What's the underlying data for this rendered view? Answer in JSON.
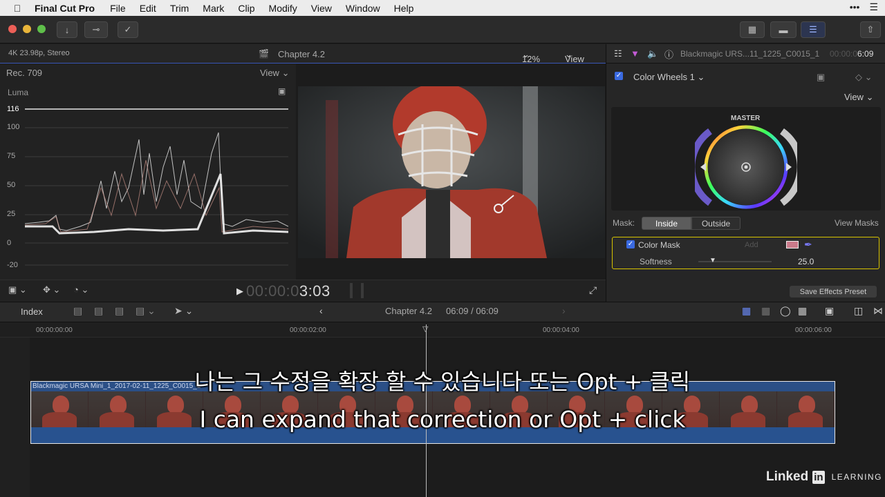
{
  "menubar": {
    "app_name": "Final Cut Pro",
    "items": [
      "File",
      "Edit",
      "Trim",
      "Mark",
      "Clip",
      "Modify",
      "View",
      "Window",
      "Help"
    ]
  },
  "viewer": {
    "format_info": "4K 23.98p, Stereo",
    "title": "Chapter 4.2",
    "zoom": "12%",
    "view_label": "View",
    "timecode_dim": "00:00:0",
    "timecode_bright": "3:03"
  },
  "scopes": {
    "colorspace": "Rec. 709",
    "view_label": "View",
    "mode": "Luma",
    "y_labels": [
      "116",
      "100",
      "75",
      "50",
      "25",
      "0",
      "-20"
    ]
  },
  "inspector": {
    "clip_name": "Blackmagic URS...11_1225_C0015_1",
    "duration_dim": "00:00:0",
    "duration_bright": "6:09",
    "effect_name": "Color Wheels 1",
    "view_label": "View",
    "wheel_label": "MASTER",
    "mask_label": "Mask:",
    "mask_inside": "Inside",
    "mask_outside": "Outside",
    "view_masks": "View Masks",
    "color_mask_label": "Color Mask",
    "add_label": "Add",
    "softness_label": "Softness",
    "softness_value": "25.0",
    "save_preset": "Save Effects Preset"
  },
  "timeline": {
    "index_label": "Index",
    "title": "Chapter 4.2",
    "position": "06:09 / 06:09",
    "ruler": [
      "00:00:00:00",
      "00:00:02:00",
      "00:00:04:00",
      "00:00:06:00"
    ],
    "clip_label": "Blackmagic URSA Mini_1_2017-02-11_1225_C0015_1"
  },
  "subtitles": {
    "korean": "나는 그 수정을 확장 할 수 있습니다 또는 Opt + 클릭",
    "english": "I can expand that correction or Opt + click"
  },
  "brand": {
    "linked": "Linked",
    "in": "in",
    "learning": "LEARNING"
  }
}
